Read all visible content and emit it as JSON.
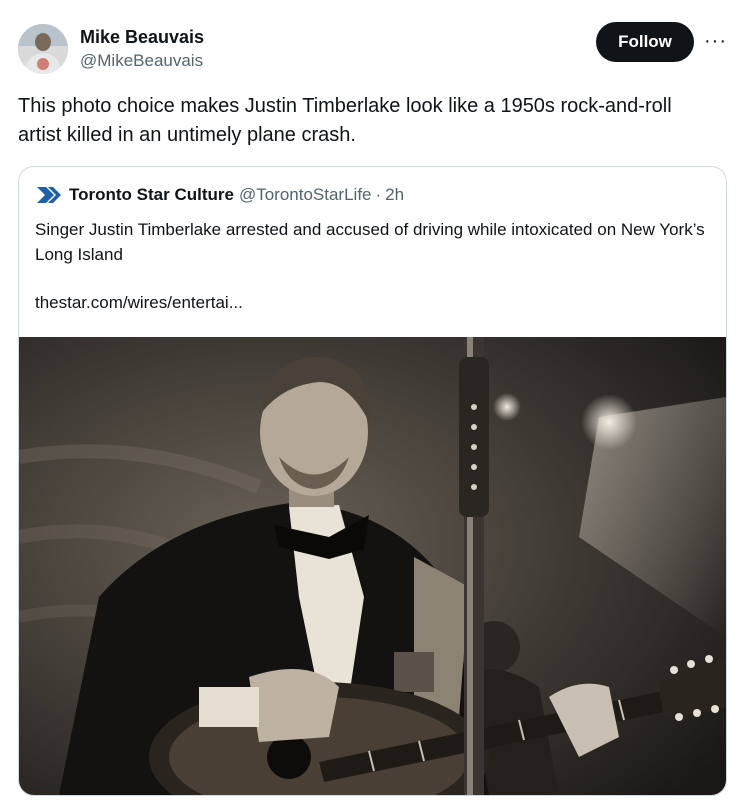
{
  "author": {
    "name": "Mike Beauvais",
    "handle": "@MikeBeauvais"
  },
  "actions": {
    "follow_label": "Follow",
    "more_label": "···"
  },
  "tweet": {
    "text": "This photo choice makes Justin Timberlake look like a 1950s rock-and-roll artist killed in an untimely plane crash."
  },
  "quote": {
    "name": "Toronto Star Culture",
    "handle": "@TorontoStarLife",
    "separator": "·",
    "time": "2h",
    "text": "Singer Justin Timberlake arrested and accused of driving while intoxicated on New York’s Long Island",
    "link": "thestar.com/wires/entertai..."
  },
  "icons": {
    "avatar": "avatar-photo",
    "logo": "toronto-star-chevron-logo",
    "more": "more-dots-icon"
  },
  "colors": {
    "text": "#0f1419",
    "secondary": "#536471",
    "border": "#cfd9de",
    "follow_bg": "#0f1419",
    "logo_blue": "#1d5fa8"
  }
}
